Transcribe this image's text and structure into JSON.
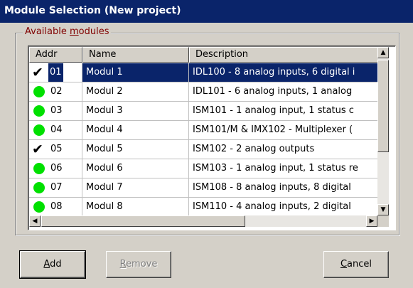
{
  "window": {
    "title": "Module Selection (New project)"
  },
  "group": {
    "label_prefix": "Available ",
    "label_accel": "m",
    "label_rest": "odules"
  },
  "table": {
    "columns": [
      "Addr",
      "Name",
      "Description"
    ],
    "rows": [
      {
        "addr": "01",
        "name": "Modul 1",
        "description": "IDL100 - 8 analog inputs, 6 digital i",
        "status": "checked",
        "selected": true
      },
      {
        "addr": "02",
        "name": "Modul 2",
        "description": "IDL101 - 6 analog inputs, 1 analog",
        "status": "available",
        "selected": false
      },
      {
        "addr": "03",
        "name": "Modul 3",
        "description": "ISM101 - 1 analog input, 1 status c",
        "status": "available",
        "selected": false
      },
      {
        "addr": "04",
        "name": "Modul 4",
        "description": "ISM101/M & IMX102 - Multiplexer (",
        "status": "available",
        "selected": false
      },
      {
        "addr": "05",
        "name": "Modul 5",
        "description": "ISM102 - 2 analog outputs",
        "status": "checked",
        "selected": false
      },
      {
        "addr": "06",
        "name": "Modul 6",
        "description": "ISM103 - 1 analog input, 1 status re",
        "status": "available",
        "selected": false
      },
      {
        "addr": "07",
        "name": "Modul 7",
        "description": "ISM108 - 8 analog inputs, 8 digital",
        "status": "available",
        "selected": false
      },
      {
        "addr": "08",
        "name": "Modul 8",
        "description": "ISM110 - 4 analog inputs, 2 digital",
        "status": "available",
        "selected": false
      }
    ]
  },
  "buttons": {
    "add": {
      "accel": "A",
      "rest": "dd"
    },
    "remove": {
      "accel": "R",
      "rest": "emove"
    },
    "cancel": {
      "accel": "C",
      "rest": "ancel"
    }
  },
  "icons": {
    "checked": "check-icon",
    "available": "green-dot-icon",
    "scroll_up": "arrow-up-icon",
    "scroll_down": "arrow-down-icon",
    "scroll_left": "arrow-left-icon",
    "scroll_right": "arrow-right-icon"
  },
  "colors": {
    "titlebar": "#0a246a",
    "selection": "#0a246a",
    "status_dot": "#00e000",
    "group_label": "#800000"
  }
}
